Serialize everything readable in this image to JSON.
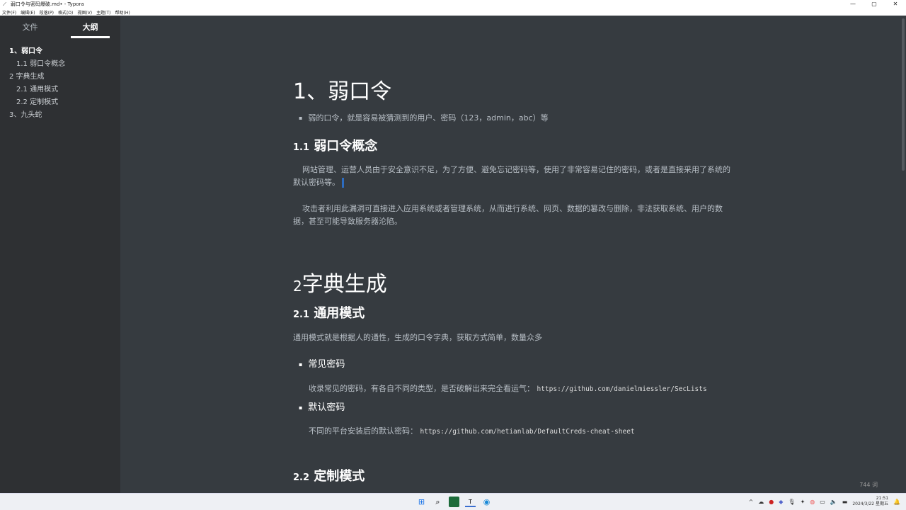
{
  "window": {
    "title": "弱口令与密码爆破.md• - Typora",
    "min": "—",
    "max": "▢",
    "close": "✕"
  },
  "menu": [
    "文件(F)",
    "编辑(E)",
    "段落(P)",
    "格式(O)",
    "视图(V)",
    "主题(T)",
    "帮助(H)"
  ],
  "sidebar": {
    "tabs": [
      "文件",
      "大纲"
    ],
    "outline": [
      {
        "label": "1、弱口令",
        "level": 1
      },
      {
        "label": "1.1 弱口令概念",
        "level": 2
      },
      {
        "label": "2 字典生成",
        "level": 1
      },
      {
        "label": "2.1 通用模式",
        "level": 2
      },
      {
        "label": "2.2 定制模式",
        "level": 2
      },
      {
        "label": "3、九头蛇",
        "level": 1
      }
    ]
  },
  "footer": {
    "back": "‹",
    "source": "</>",
    "word_count": "744 词"
  },
  "doc": {
    "h1a": "1、弱口令",
    "bullet1": "弱的口令，就是容易被猜测到的用户、密码（123，admin，abc）等",
    "h2a_num": "1.1",
    "h2a": "弱口令概念",
    "p1": "网站管理、运营人员由于安全意识不足，为了方便、避免忘记密码等，使用了非常容易记住的密码，或者是直接采用了系统的默认密码等。",
    "p2": "攻击者利用此漏洞可直接进入应用系统或者管理系统，从而进行系统、网页、数据的篡改与删除，非法获取系统、用户的数据，甚至可能导致服务器沦陷。",
    "h1b_num": "2",
    "h1b": "字典生成",
    "h2b_num": "2.1",
    "h2b": "通用模式",
    "p3": "通用模式就是根据人的通性，生成的口令字典，获取方式简单，数量众多",
    "li2": "常见密码",
    "p4": "收录常见的密码，有各自不同的类型，是否破解出来完全看运气：",
    "url1": "https://github.com/danielmiessler/SecLists",
    "li3": "默认密码",
    "p5": "不同的平台安装后的默认密码：",
    "url2": "https://github.com/hetianlab/DefaultCreds-cheat-sheet",
    "h2c_num": "2.2",
    "h2c": "定制模式"
  },
  "taskbar": {
    "time": "21:51",
    "date": "2024/3/22 星期五"
  }
}
